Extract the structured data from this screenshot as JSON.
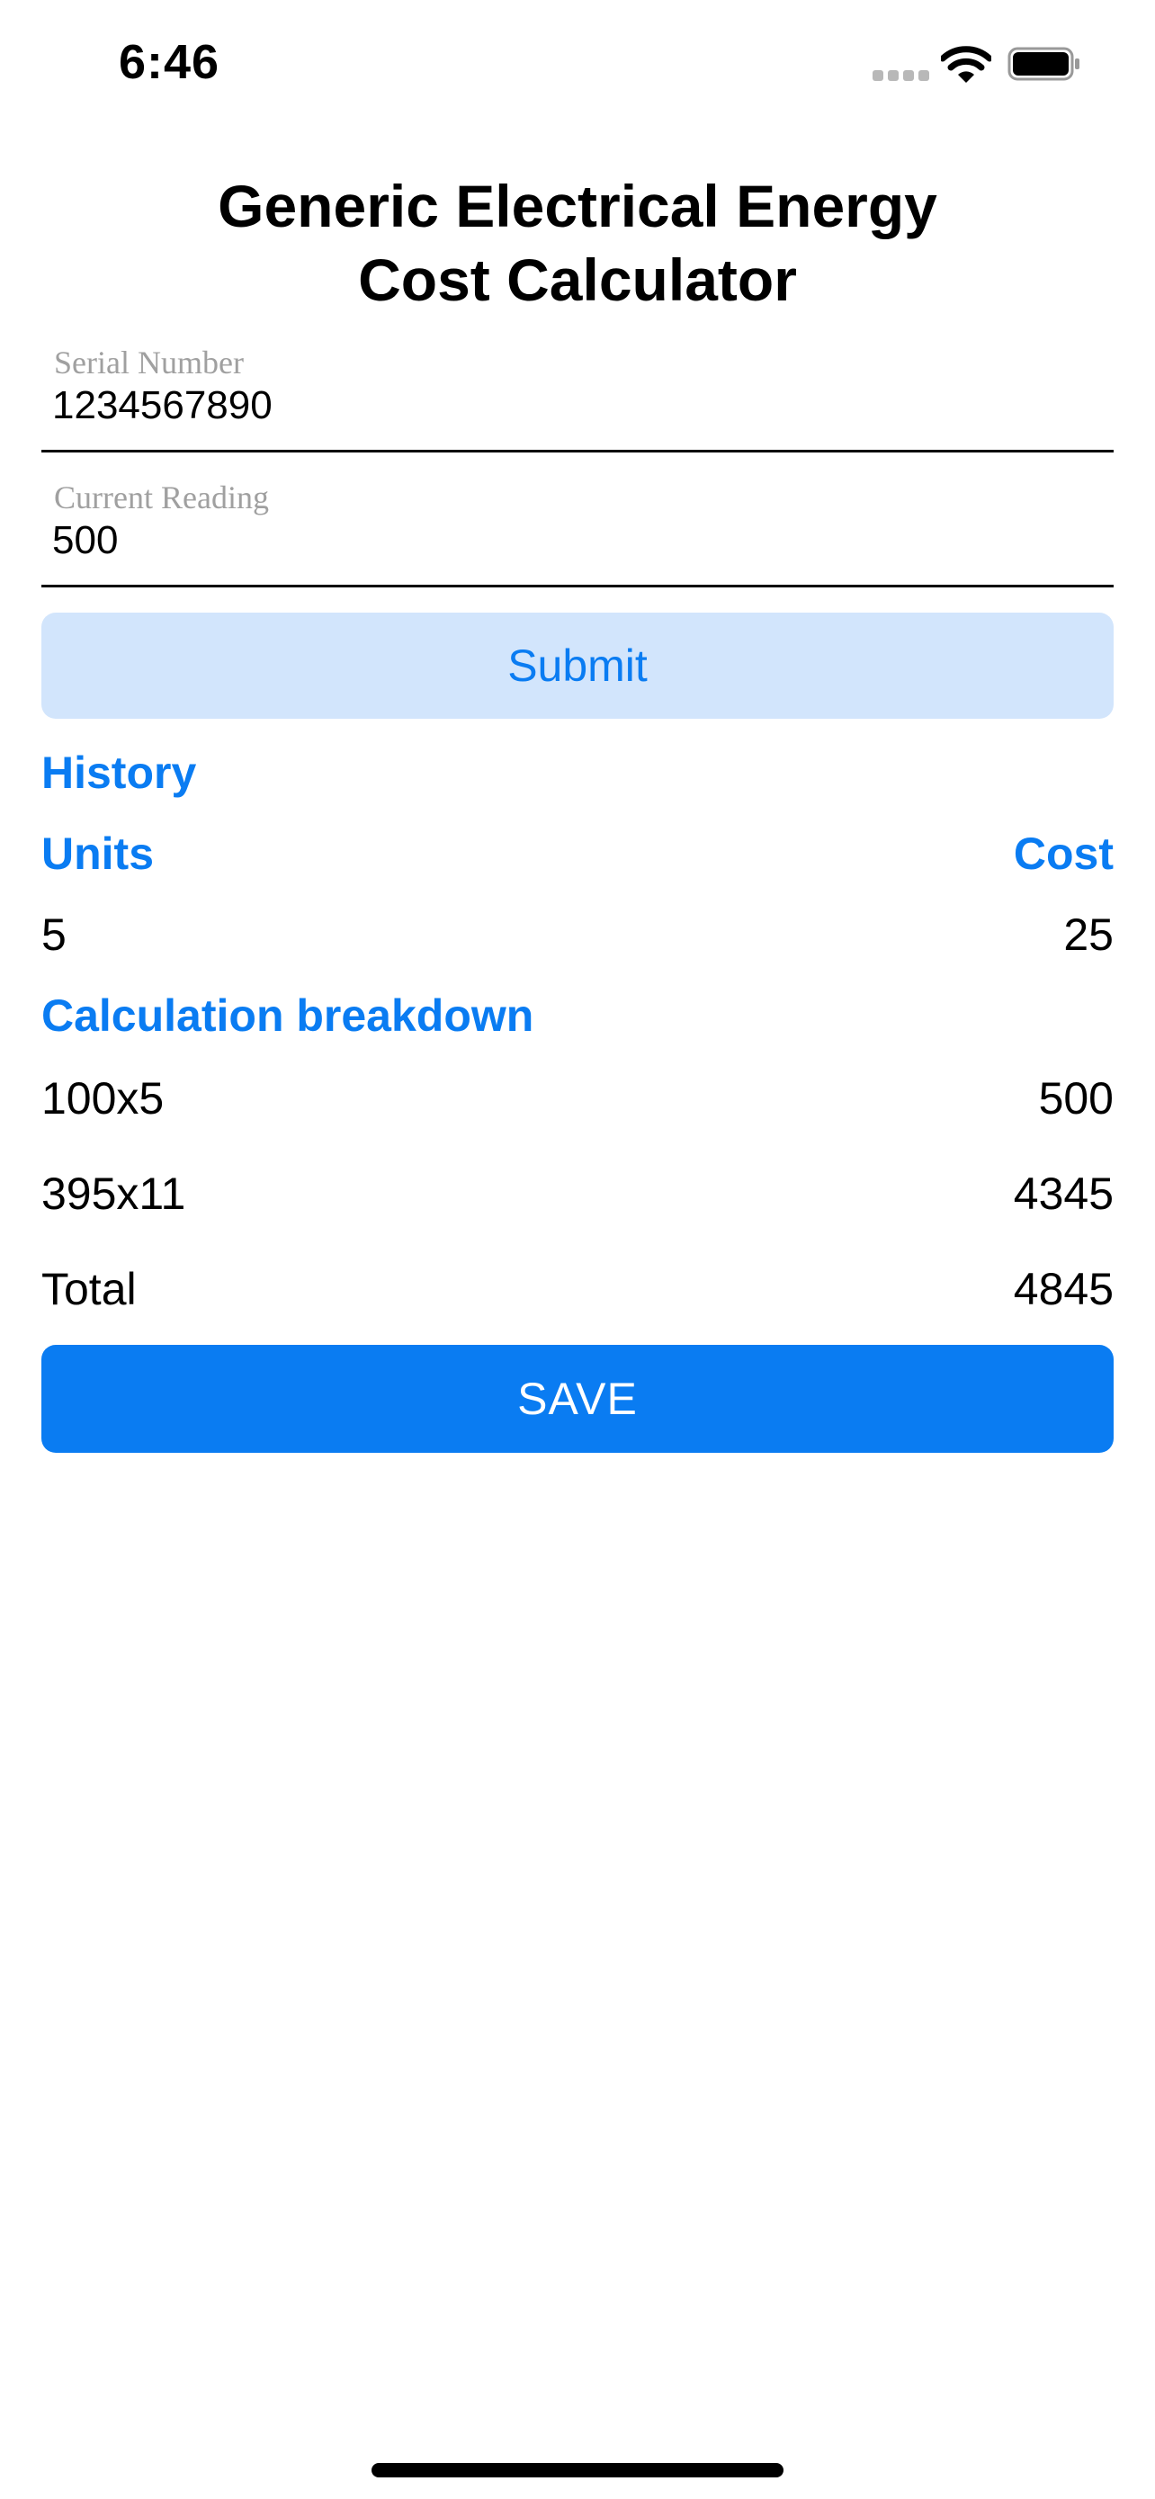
{
  "status_bar": {
    "time": "6:46",
    "icons": [
      "signal-icon",
      "wifi-icon",
      "battery-icon"
    ]
  },
  "title": {
    "line1": "Generic Electrical Energy",
    "line2": "Cost Calculator"
  },
  "serial_field": {
    "label": "Serial Number",
    "value": "1234567890"
  },
  "reading_field": {
    "label": "Current Reading",
    "value": "500"
  },
  "submit_label": "Submit",
  "history": {
    "heading": "History",
    "col_units": "Units",
    "col_cost": "Cost",
    "rows": [
      {
        "units": "5",
        "cost": "25"
      }
    ]
  },
  "breakdown": {
    "heading": "Calculation breakdown",
    "rows": [
      {
        "label": "100x5",
        "value": "500"
      },
      {
        "label": "395x11",
        "value": "4345"
      },
      {
        "label": "Total",
        "value": "4845"
      }
    ]
  },
  "save_label": "SAVE",
  "colors": {
    "accent": "#0a7cf2",
    "submit_bg": "#d2e5fc",
    "label_gray": "#a0a0a0"
  }
}
